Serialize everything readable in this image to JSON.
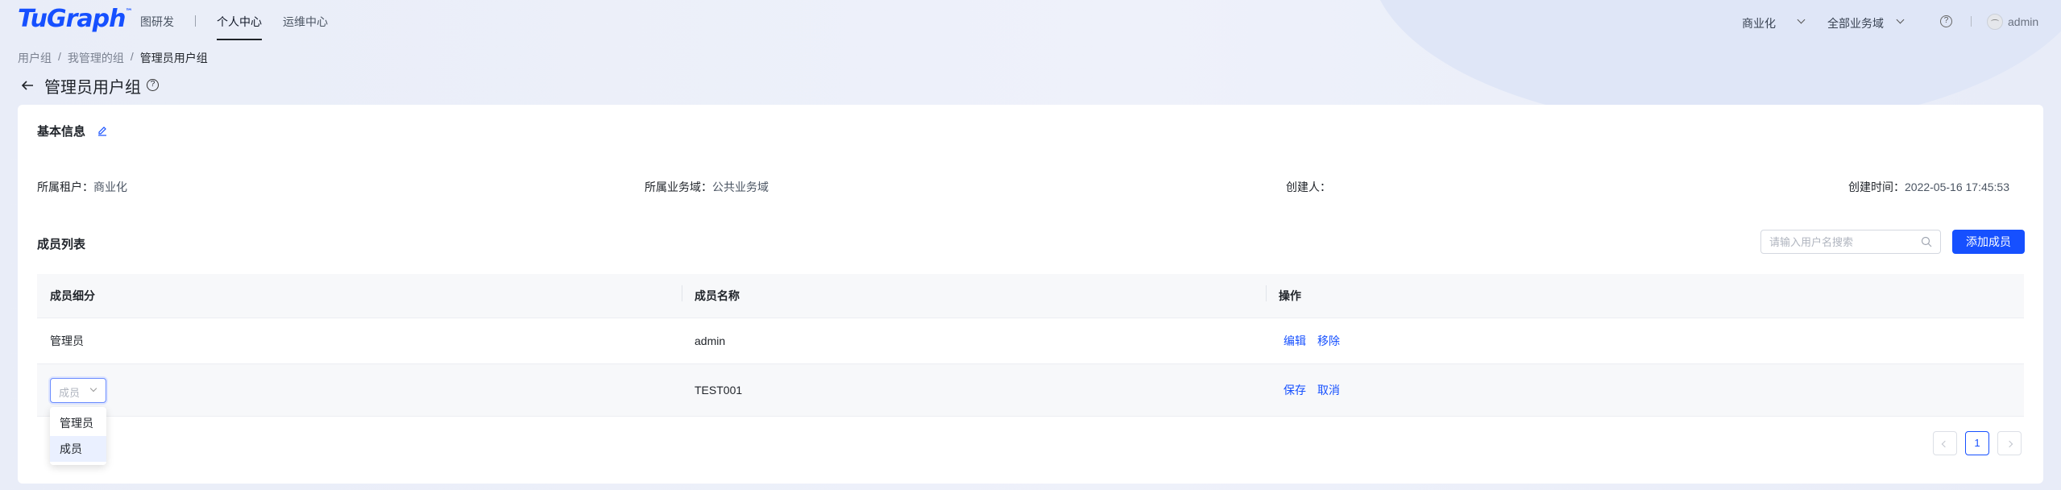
{
  "header": {
    "logo_text": "TuGraph",
    "logo_mark": "™",
    "nav": [
      {
        "label": "图研发"
      },
      {
        "label": "个人中心"
      },
      {
        "label": "运维中心"
      }
    ],
    "tenant_select": "商业化",
    "domain_select": "全部业务域",
    "user_name": "admin"
  },
  "breadcrumb": {
    "items": [
      "用户组",
      "我管理的组",
      "管理员用户组"
    ],
    "separator": "/"
  },
  "page": {
    "title": "管理员用户组"
  },
  "basic_info": {
    "title": "基本信息",
    "tenant_label": "所属租户：",
    "tenant_value": "商业化",
    "domain_label": "所属业务域：",
    "domain_value": "公共业务域",
    "creator_label": "创建人：",
    "creator_value": "",
    "created_label": "创建时间：",
    "created_value": "2022-05-16 17:45:53"
  },
  "members": {
    "title": "成员列表",
    "search_placeholder": "请输入用户名搜索",
    "add_button": "添加成员",
    "columns": [
      "成员细分",
      "成员名称",
      "操作"
    ],
    "rows": [
      {
        "role": "管理员",
        "name": "admin",
        "actions": [
          "编辑",
          "移除"
        ]
      },
      {
        "role_select": "成员",
        "name": "TEST001",
        "actions": [
          "保存",
          "取消"
        ]
      }
    ],
    "dropdown_options": [
      "管理员",
      "成员"
    ],
    "dropdown_selected": "成员"
  },
  "pagination": {
    "current_page": "1"
  },
  "colors": {
    "primary": "#1650ff",
    "text": "#1f2329"
  }
}
